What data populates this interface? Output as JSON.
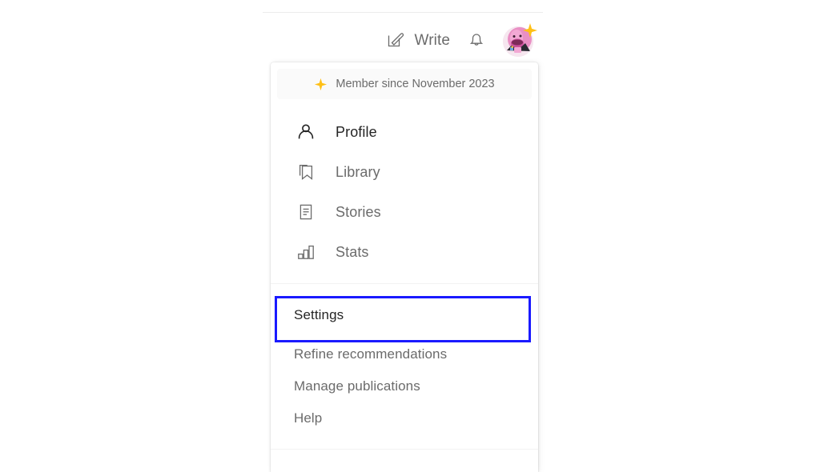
{
  "topbar": {
    "write_label": "Write",
    "write_icon": "write-pencil-square-icon",
    "notifications_icon": "bell-icon",
    "avatar_icon": "user-avatar",
    "avatar_badge_icon": "star-sparkle-icon"
  },
  "dropdown": {
    "membership": {
      "icon": "star-sparkle-icon",
      "text": "Member since November 2023",
      "star_color": "#FFC017",
      "background": "#FAFAFA"
    },
    "primary_items": [
      {
        "label": "Profile",
        "icon": "person-icon",
        "active": true
      },
      {
        "label": "Library",
        "icon": "bookmark-icon",
        "active": false
      },
      {
        "label": "Stories",
        "icon": "document-icon",
        "active": false
      },
      {
        "label": "Stats",
        "icon": "bar-chart-icon",
        "active": false
      }
    ],
    "secondary_items": [
      {
        "label": "Settings",
        "active": true
      },
      {
        "label": "Refine recommendations",
        "active": false
      },
      {
        "label": "Manage publications",
        "active": false
      },
      {
        "label": "Help",
        "active": false
      }
    ],
    "highlight": {
      "target_label": "Settings",
      "color": "#1A1AFF"
    }
  },
  "colors": {
    "text_dark": "#242424",
    "text_muted": "#6B6B6B",
    "divider": "#F2F2F2",
    "accent_gold": "#FFC017",
    "highlight_blue": "#1A1AFF"
  }
}
